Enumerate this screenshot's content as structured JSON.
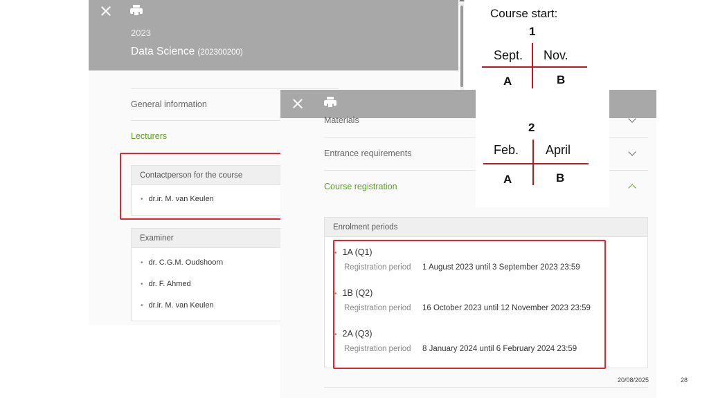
{
  "back_window": {
    "year": "2023",
    "course_name": "Data Science",
    "course_code": "(202300200)",
    "nav": {
      "general_information": "General information",
      "lecturers": "Lecturers"
    },
    "contact_card": {
      "heading": "Contactperson for the course",
      "people": [
        "dr.ir. M. van Keulen"
      ]
    },
    "examiner_card": {
      "heading": "Examiner",
      "people": [
        "dr. C.G.M. Oudshoorn",
        "dr. F. Ahmed",
        "dr.ir. M. van Keulen"
      ]
    }
  },
  "front_window": {
    "nav": {
      "materials": "Materials",
      "entrance_requirements": "Entrance requirements",
      "course_registration": "Course registration"
    },
    "enrolment": {
      "heading": "Enrolment periods",
      "periods": [
        {
          "name": "1A (Q1)",
          "key": "Registration period",
          "value": "1 August 2023 until 3 September 2023 23:59"
        },
        {
          "name": "1B (Q2)",
          "key": "Registration period",
          "value": "16 October 2023 until 12 November 2023 23:59"
        },
        {
          "name": "2A (Q3)",
          "key": "Registration period",
          "value": "8 January 2024 until 6 February 2024 23:59"
        }
      ]
    }
  },
  "diagram": {
    "title": "Course start:",
    "block1": {
      "number": "1",
      "left_month": "Sept.",
      "right_month": "Nov.",
      "left_letter": "A",
      "right_letter": "B"
    },
    "block2": {
      "number": "2",
      "left_month": "Feb.",
      "right_month": "April",
      "left_letter": "A",
      "right_letter": "B"
    }
  },
  "footer": {
    "date": "20/08/2025",
    "page_number": "28"
  },
  "colors": {
    "header_gray": "#a8a8a8",
    "link_green": "#5a9e1e",
    "highlight_red": "#e0262e"
  }
}
